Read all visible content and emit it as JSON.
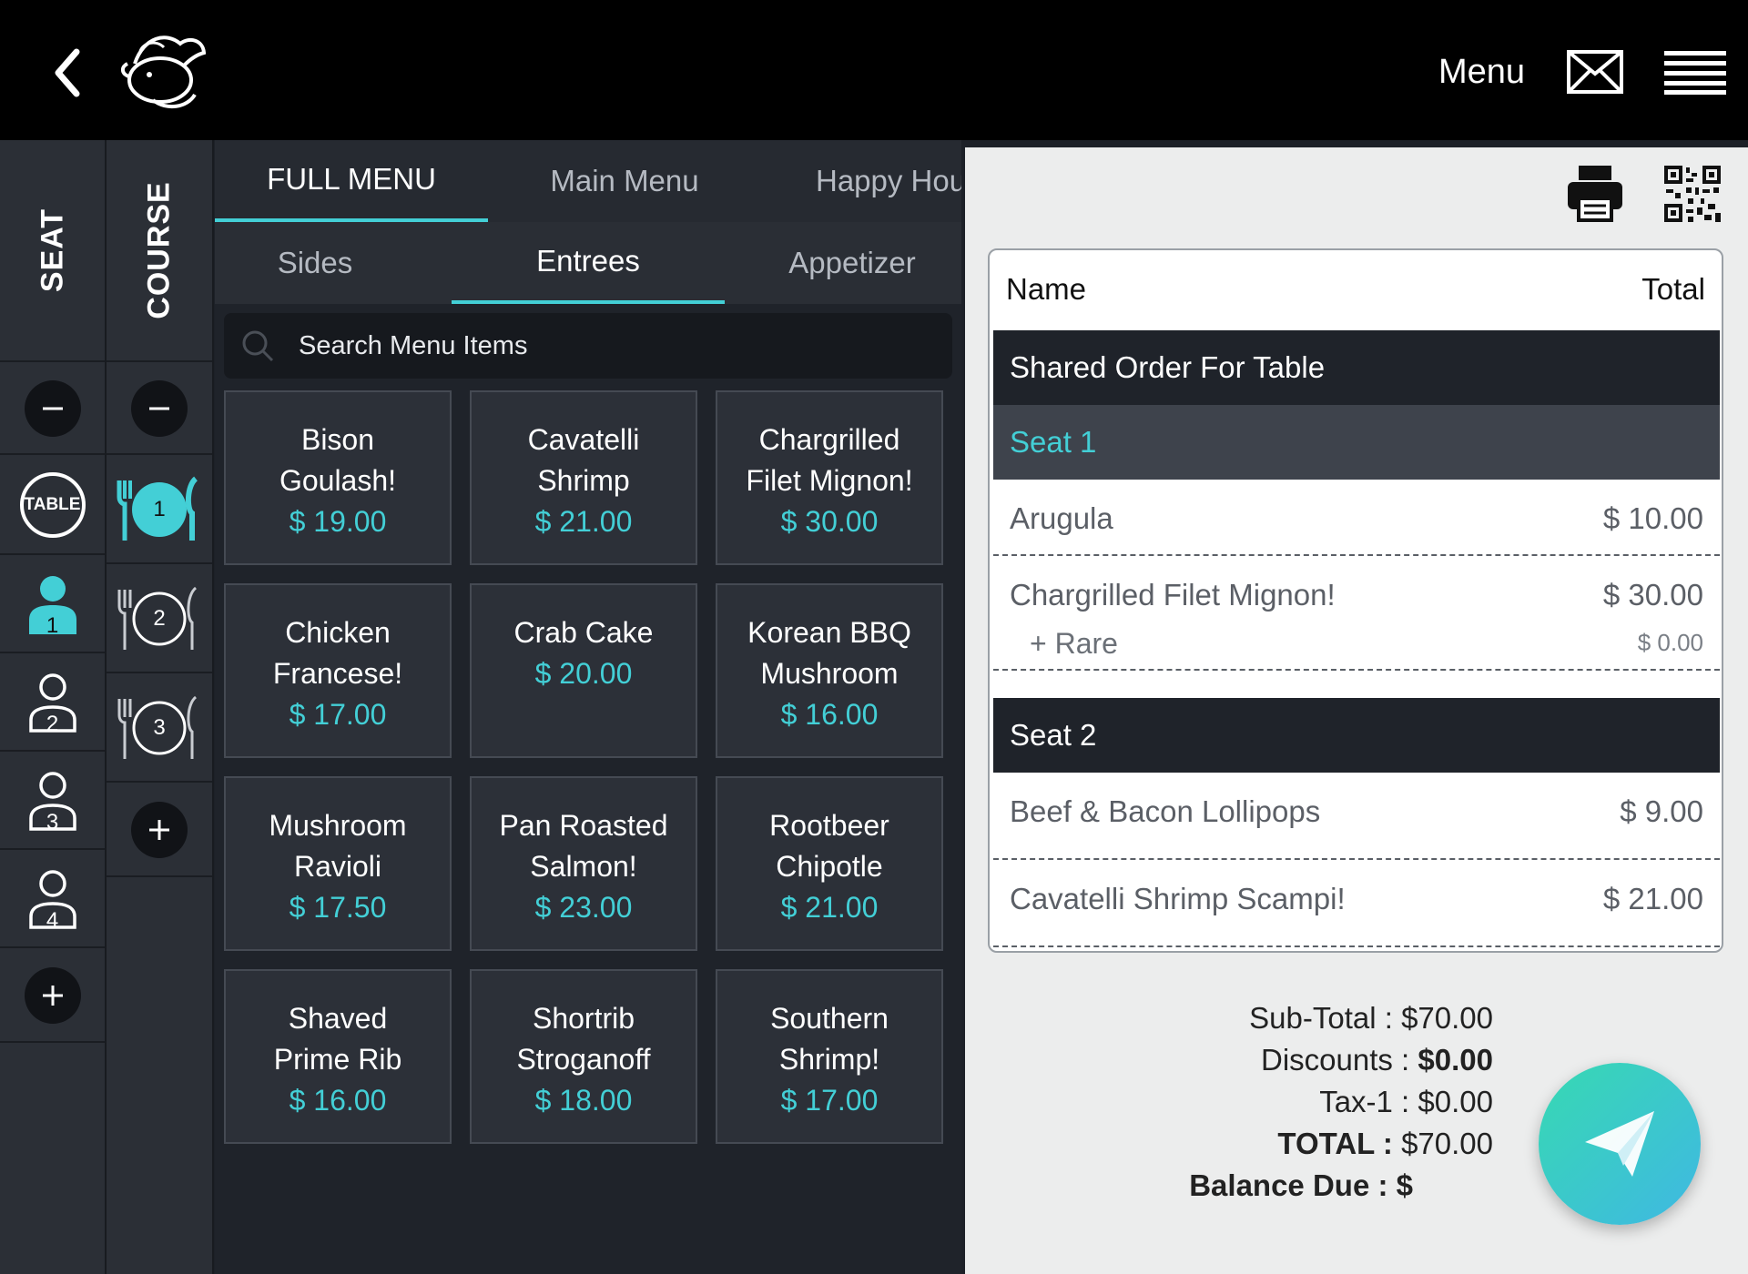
{
  "header": {
    "menu_label": "Menu"
  },
  "seat_column": {
    "label": "SEAT",
    "table_label": "TABLE",
    "seats": [
      "1",
      "2",
      "3",
      "4"
    ],
    "selected_seat": "1"
  },
  "course_column": {
    "label": "COURSE",
    "courses": [
      "1",
      "2",
      "3"
    ],
    "selected_course": "1"
  },
  "menu_tabs": [
    {
      "label": "FULL MENU",
      "active": true
    },
    {
      "label": "Main Menu",
      "active": false
    },
    {
      "label": "Happy Hou",
      "active": false
    }
  ],
  "category_tabs": [
    {
      "label": "Sides",
      "active": false
    },
    {
      "label": "Entrees",
      "active": true
    },
    {
      "label": "Appetizer",
      "active": false
    }
  ],
  "search": {
    "placeholder": "Search Menu Items"
  },
  "items": [
    {
      "name": [
        "Bison",
        "Goulash!"
      ],
      "price": "$ 19.00"
    },
    {
      "name": [
        "Cavatelli",
        "Shrimp"
      ],
      "price": "$ 21.00"
    },
    {
      "name": [
        "Chargrilled",
        "Filet Mignon!"
      ],
      "price": "$ 30.00"
    },
    {
      "name": [
        "Chicken",
        "Francese!"
      ],
      "price": "$ 17.00"
    },
    {
      "name": [
        "Crab Cake"
      ],
      "price": "$ 20.00"
    },
    {
      "name": [
        "Korean BBQ",
        "Mushroom"
      ],
      "price": "$ 16.00"
    },
    {
      "name": [
        "Mushroom",
        "Ravioli"
      ],
      "price": "$ 17.50"
    },
    {
      "name": [
        "Pan Roasted",
        "Salmon!"
      ],
      "price": "$ 23.00"
    },
    {
      "name": [
        "Rootbeer",
        "Chipotle"
      ],
      "price": "$ 21.00"
    },
    {
      "name": [
        "Shaved",
        "Prime Rib"
      ],
      "price": "$ 16.00"
    },
    {
      "name": [
        "Shortrib",
        "Stroganoff"
      ],
      "price": "$ 18.00"
    },
    {
      "name": [
        "Southern",
        "Shrimp!"
      ],
      "price": "$ 17.00"
    }
  ],
  "order": {
    "header_name": "Name",
    "header_total": "Total",
    "shared_label": "Shared Order For Table",
    "seat1_label": "Seat 1",
    "seat1_lines": [
      {
        "name": "Arugula",
        "price": "$ 10.00"
      },
      {
        "name": "Chargrilled Filet Mignon!",
        "price": "$ 30.00",
        "modifier": "+ Rare",
        "modifier_price": "$ 0.00"
      }
    ],
    "seat2_label": "Seat 2",
    "seat2_lines": [
      {
        "name": "Beef & Bacon Lollipops",
        "price": "$ 9.00"
      },
      {
        "name": "Cavatelli Shrimp Scampi!",
        "price": "$ 21.00"
      }
    ]
  },
  "totals": {
    "subtotal_label": "Sub-Total :",
    "subtotal_value": "$70.00",
    "discounts_label": "Discounts :",
    "discounts_value": "$0.00",
    "tax_label": "Tax-1 :",
    "tax_value": "$0.00",
    "total_label": "TOTAL :",
    "total_value": "$70.00",
    "balance_label": "Balance Due :",
    "balance_value": "$"
  },
  "colors": {
    "accent": "#43cfd6",
    "dark": "#1f232a",
    "send_start": "#37d9b2",
    "send_end": "#3fb8e3"
  }
}
